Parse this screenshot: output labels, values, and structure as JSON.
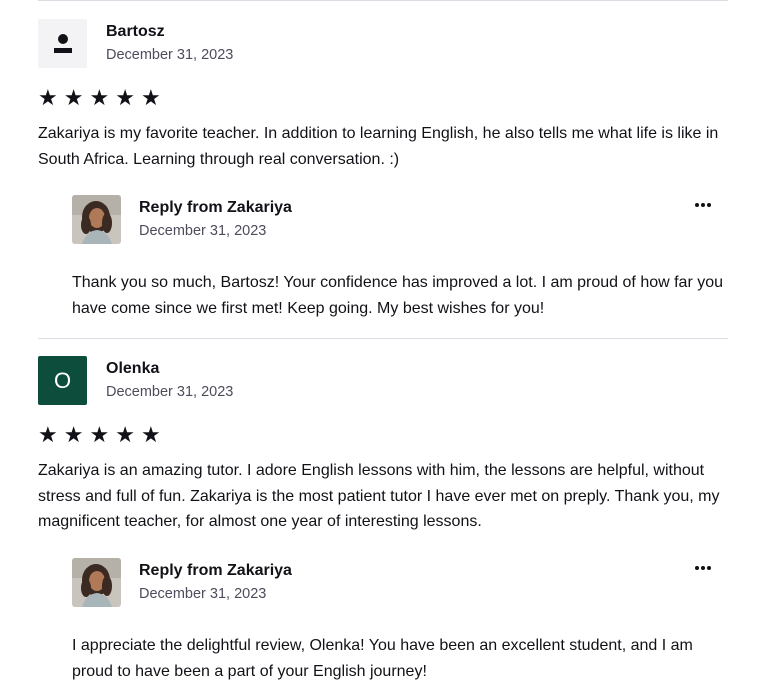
{
  "reviews": [
    {
      "author": "Bartosz",
      "avatar_type": "person-placeholder-icon",
      "date": "December 31, 2023",
      "rating": 5,
      "stars": [
        "★",
        "★",
        "★",
        "★",
        "★"
      ],
      "text": "Zakariya is my favorite teacher. In addition to learning English, he also tells me what life is like in South Africa. Learning through real conversation. :)",
      "reply": {
        "title": "Reply from Zakariya",
        "date": "December 31, 2023",
        "more_icon": "more-horizontal-icon",
        "text": "Thank you so much, Bartosz! Your confidence has improved a lot. I am proud of how far you have come since we first met! Keep going. My best wishes for you!"
      }
    },
    {
      "author": "Olenka",
      "avatar_letter": "O",
      "avatar_color": "#0c4d3c",
      "date": "December 31, 2023",
      "rating": 5,
      "stars": [
        "★",
        "★",
        "★",
        "★",
        "★"
      ],
      "text": "Zakariya is an amazing tutor. I adore English lessons with him, the lessons are helpful, without stress and full of fun. Zakariya is the most patient tutor I have ever met on preply. Thank you, my magnificent teacher, for almost one year of interesting lessons.",
      "reply": {
        "title": "Reply from Zakariya",
        "date": "December 31, 2023",
        "more_icon": "more-horizontal-icon",
        "text": "I appreciate the delightful review, Olenka! You have been an excellent student, and I am proud to have been a part of your English journey!"
      }
    }
  ]
}
